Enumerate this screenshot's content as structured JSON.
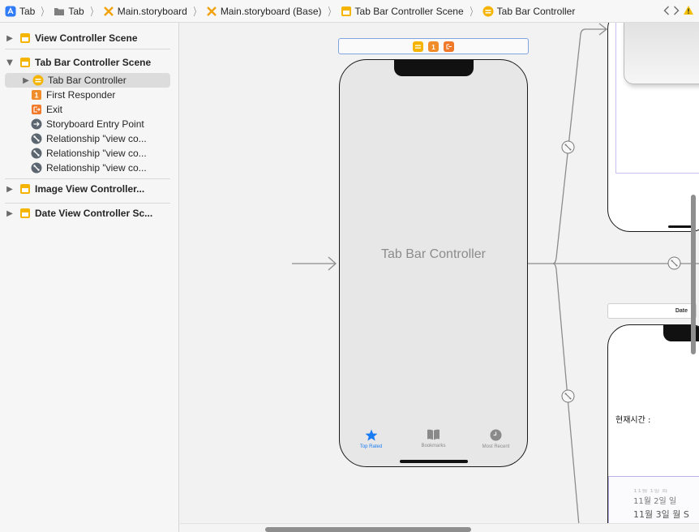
{
  "jumpbar": {
    "crumbs": [
      {
        "label": "Tab",
        "icon": "app-icon"
      },
      {
        "label": "Tab",
        "icon": "folder-icon"
      },
      {
        "label": "Main.storyboard",
        "icon": "storyboard-icon"
      },
      {
        "label": "Main.storyboard (Base)",
        "icon": "storyboard-icon"
      },
      {
        "label": "Tab Bar Controller Scene",
        "icon": "scene-icon"
      },
      {
        "label": "Tab Bar Controller",
        "icon": "tab-bar-controller-icon"
      }
    ],
    "separator": "〉"
  },
  "navigator": {
    "items": [
      {
        "label": "View Controller Scene"
      },
      {
        "label": "Tab Bar Controller Scene"
      },
      {
        "label": "Tab Bar Controller"
      },
      {
        "label": "First Responder"
      },
      {
        "label": "Exit"
      },
      {
        "label": "Storyboard Entry Point"
      },
      {
        "label": "Relationship \"view co..."
      },
      {
        "label": "Relationship \"view co..."
      },
      {
        "label": "Relationship \"view co..."
      },
      {
        "label": "Image View Controller..."
      },
      {
        "label": "Date View Controller Sc..."
      }
    ]
  },
  "canvas": {
    "scene_title": "Tab Bar Controller",
    "tabs": [
      {
        "label": "Top Rated",
        "icon": "star-icon"
      },
      {
        "label": "Bookmarks",
        "icon": "book-icon"
      },
      {
        "label": "Most Recent",
        "icon": "clock-icon"
      }
    ],
    "date_scene_dock_label": "Date",
    "time_label": "현재시간 :",
    "picker_rows": [
      "11월 1일 화",
      "11월 2일 일",
      "11월 3일 월 S"
    ]
  },
  "colors": {
    "accent": "#1a7cf5",
    "scene_yellow": "#f5b400",
    "responder_orange": "#f08c2a",
    "selection": "#dcdcdc"
  }
}
